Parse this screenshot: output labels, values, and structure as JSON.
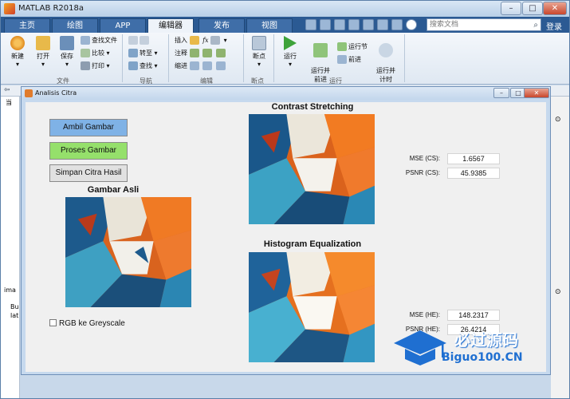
{
  "window": {
    "title": "MATLAB R2018a"
  },
  "tabs": [
    {
      "label": "主页"
    },
    {
      "label": "绘图"
    },
    {
      "label": "APP"
    },
    {
      "label": "编辑器",
      "active": true
    },
    {
      "label": "发布"
    },
    {
      "label": "视图"
    }
  ],
  "search": {
    "placeholder": "搜索文档"
  },
  "login_label": "登录",
  "ribbon": {
    "file": {
      "new": "新建",
      "open": "打开",
      "save": "保存",
      "find_files": "查找文件",
      "compare": "比较",
      "print": "打印",
      "group": "文件"
    },
    "navigate": {
      "goto": "转至",
      "find": "查找",
      "group": "导航"
    },
    "edit": {
      "insert": "插入",
      "comment": "注释",
      "indent": "缩进",
      "group": "编辑"
    },
    "breakpoints": {
      "label": "断点",
      "group": "断点"
    },
    "run": {
      "run": "运行",
      "run_advance": "运行并\n前进",
      "run_section": "运行节",
      "advance": "前进",
      "run_time": "运行并\n计时",
      "group": "运行"
    }
  },
  "workspace": {
    "current_folder_prefix": "当",
    "cmd_prefix": "ima",
    "cmd_text": "Bu\nlat"
  },
  "figure": {
    "title": "Analisis Citra",
    "buttons": {
      "ambil": "Ambil Gambar",
      "proses": "Proses Gambar",
      "simpan": "Simpan Citra Hasil"
    },
    "headings": {
      "asli": "Gambar Asli",
      "cs": "Contrast Stretching",
      "he": "Histogram Equalization"
    },
    "checkbox_label": "RGB ke Greyscale",
    "metrics": {
      "mse_cs_label": "MSE (CS):",
      "mse_cs": "1.6567",
      "psnr_cs_label": "PSNR (CS):",
      "psnr_cs": "45.9385",
      "mse_he_label": "MSE (HE):",
      "mse_he": "148.2317",
      "psnr_he_label": "PSNR (HE):",
      "psnr_he": "26.4214"
    }
  },
  "watermark": {
    "cn": "必过源码",
    "en": "Biguo100.CN"
  },
  "colors": {
    "btn_blue": "#7fb2e6",
    "btn_green": "#95e06b",
    "btn_gray": "#e1e1e1"
  }
}
